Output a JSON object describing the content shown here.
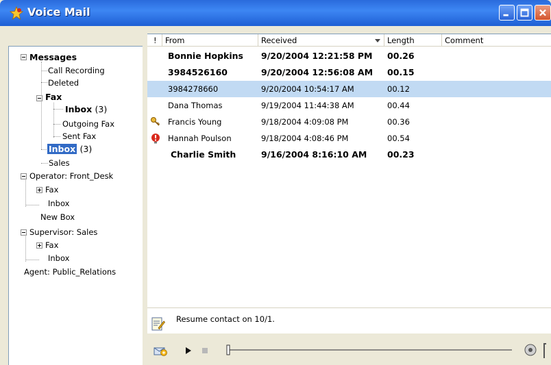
{
  "window": {
    "title": "Voice Mail",
    "colors": {
      "titlebar": "#2a6bdc",
      "selection": "#316ac5",
      "selected_row": "#c1daf3"
    }
  },
  "tree": {
    "messages": "Messages",
    "call_recording": "Call Recording",
    "deleted": "Deleted",
    "fax": "Fax",
    "fax_inbox": "Inbox",
    "fax_inbox_count": "(3)",
    "outgoing_fax": "Outgoing Fax",
    "sent_fax": "Sent Fax",
    "inbox": "Inbox",
    "inbox_count": "(3)",
    "sales": "Sales",
    "operator": "Operator: Front_Desk",
    "op_fax": "Fax",
    "op_inbox": "Inbox",
    "op_new_box": "New Box",
    "supervisor": "Supervisor: Sales",
    "sup_fax": "Fax",
    "sup_inbox": "Inbox",
    "agent": "Agent: Public_Relations"
  },
  "columns": {
    "flag": "!",
    "from": "From",
    "received": "Received",
    "length": "Length",
    "comment": "Comment"
  },
  "messages": [
    {
      "from": "Bonnie Hopkins",
      "received": "9/20/2004 12:21:58 PM",
      "length": "00.26",
      "comment": ""
    },
    {
      "from": "3984526160",
      "received": "9/20/2004 12:56:08 AM",
      "length": "00.15",
      "comment": ""
    },
    {
      "from": "3984278660",
      "received": "9/20/2004 10:54:17 AM",
      "length": "00.12",
      "comment": ""
    },
    {
      "from": "Dana Thomas",
      "received": "9/19/2004 11:44:38 AM",
      "length": "00.44",
      "comment": ""
    },
    {
      "from": "Francis Young",
      "received": "9/18/2004 4:09:08 PM",
      "length": "00.36",
      "comment": "",
      "icon": "key-icon"
    },
    {
      "from": "Hannah Poulson",
      "received": "9/18/2004 4:08:46 PM",
      "length": "00.54",
      "comment": "",
      "icon": "urgent-icon"
    },
    {
      "from": "Charlie Smith",
      "received": "9/16/2004 8:16:10 AM",
      "length": "00.23",
      "comment": ""
    }
  ],
  "comment_panel": {
    "text": "Resume contact on 10/1."
  },
  "player": {
    "icons": [
      "send-mail-icon",
      "play-icon",
      "stop-icon",
      "seek-slider",
      "volume-icon"
    ]
  }
}
